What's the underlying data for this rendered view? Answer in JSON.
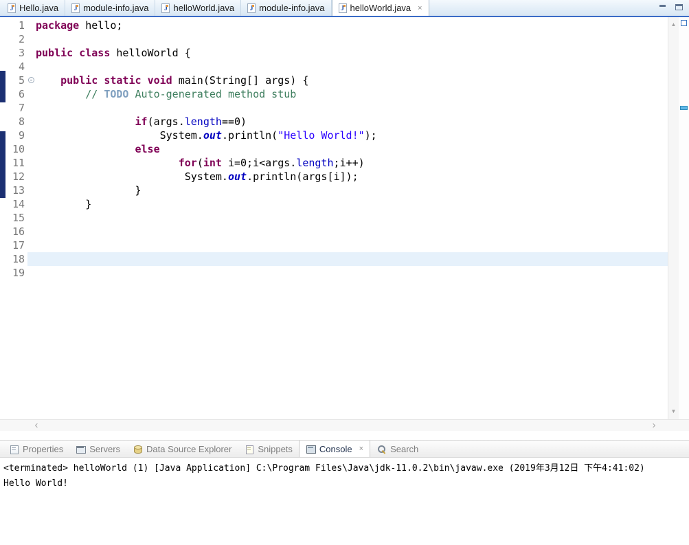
{
  "icons": {
    "java_file_glyph": "J",
    "close_glyph": "×",
    "scroll_up_glyph": "▲",
    "scroll_down_glyph": "▼",
    "scroll_left_glyph": "‹",
    "scroll_right_glyph": "›"
  },
  "colors": {
    "accent": "#3a6bc6",
    "keyword": "#7f0055",
    "string": "#2a00ff",
    "comment": "#3f7f5f",
    "todo_tag": "#7f9fbf",
    "field": "#0000c0",
    "line_number": "#787878",
    "current_line": "#e6f1fb",
    "change_bar": "#1b2f72",
    "todo_marker": "#5fb8e8"
  },
  "editor": {
    "tabs": [
      {
        "label": "Hello.java",
        "active": false
      },
      {
        "label": "module-info.java",
        "active": false
      },
      {
        "label": "helloWorld.java",
        "active": false
      },
      {
        "label": "module-info.java",
        "active": false
      },
      {
        "label": "helloWorld.java",
        "active": true
      }
    ],
    "current_line": 18,
    "fold_line": 5,
    "line_count": 19,
    "code_lines": [
      [
        {
          "t": "package",
          "c": "k"
        },
        {
          "t": " hello;",
          "c": "p"
        }
      ],
      [],
      [
        {
          "t": "public",
          "c": "k"
        },
        {
          "t": " ",
          "c": "p"
        },
        {
          "t": "class",
          "c": "k"
        },
        {
          "t": " helloWorld {",
          "c": "p"
        }
      ],
      [],
      [
        {
          "t": "    ",
          "c": "p"
        },
        {
          "t": "public",
          "c": "k"
        },
        {
          "t": " ",
          "c": "p"
        },
        {
          "t": "static",
          "c": "k"
        },
        {
          "t": " ",
          "c": "p"
        },
        {
          "t": "void",
          "c": "k"
        },
        {
          "t": " main(String[] args) {",
          "c": "p"
        }
      ],
      [
        {
          "t": "        ",
          "c": "p"
        },
        {
          "t": "// ",
          "c": "c"
        },
        {
          "t": "TODO",
          "c": "t"
        },
        {
          "t": " Auto-generated method stub",
          "c": "c"
        }
      ],
      [],
      [
        {
          "t": "                ",
          "c": "p"
        },
        {
          "t": "if",
          "c": "k"
        },
        {
          "t": "(args.",
          "c": "p"
        },
        {
          "t": "length",
          "c": "f"
        },
        {
          "t": "==0)",
          "c": "p"
        }
      ],
      [
        {
          "t": "                    System.",
          "c": "p"
        },
        {
          "t": "out",
          "c": "sf"
        },
        {
          "t": ".println(",
          "c": "p"
        },
        {
          "t": "\"Hello World!\"",
          "c": "s"
        },
        {
          "t": ");",
          "c": "p"
        }
      ],
      [
        {
          "t": "                ",
          "c": "p"
        },
        {
          "t": "else",
          "c": "k"
        }
      ],
      [
        {
          "t": "                       ",
          "c": "p"
        },
        {
          "t": "for",
          "c": "k"
        },
        {
          "t": "(",
          "c": "p"
        },
        {
          "t": "int",
          "c": "k"
        },
        {
          "t": " i=0;i<args.",
          "c": "p"
        },
        {
          "t": "length",
          "c": "f"
        },
        {
          "t": ";i++)",
          "c": "p"
        }
      ],
      [
        {
          "t": "                        System.",
          "c": "p"
        },
        {
          "t": "out",
          "c": "sf"
        },
        {
          "t": ".println(args[i]);",
          "c": "p"
        }
      ],
      [
        {
          "t": "                }",
          "c": "p"
        }
      ],
      [
        {
          "t": "        }",
          "c": "p"
        }
      ],
      [],
      [],
      [],
      [],
      []
    ]
  },
  "bottom_panel": {
    "tabs": [
      {
        "label": "Properties",
        "icon": "properties-icon",
        "active": false
      },
      {
        "label": "Servers",
        "icon": "servers-icon",
        "active": false
      },
      {
        "label": "Data Source Explorer",
        "icon": "data-source-icon",
        "active": false
      },
      {
        "label": "Snippets",
        "icon": "snippets-icon",
        "active": false
      },
      {
        "label": "Console",
        "icon": "console-icon",
        "active": true
      },
      {
        "label": "Search",
        "icon": "search-icon",
        "active": false
      }
    ]
  },
  "console": {
    "header": "<terminated> helloWorld (1) [Java Application] C:\\Program Files\\Java\\jdk-11.0.2\\bin\\javaw.exe (2019年3月12日 下午4:41:02)",
    "output": "Hello World!"
  }
}
